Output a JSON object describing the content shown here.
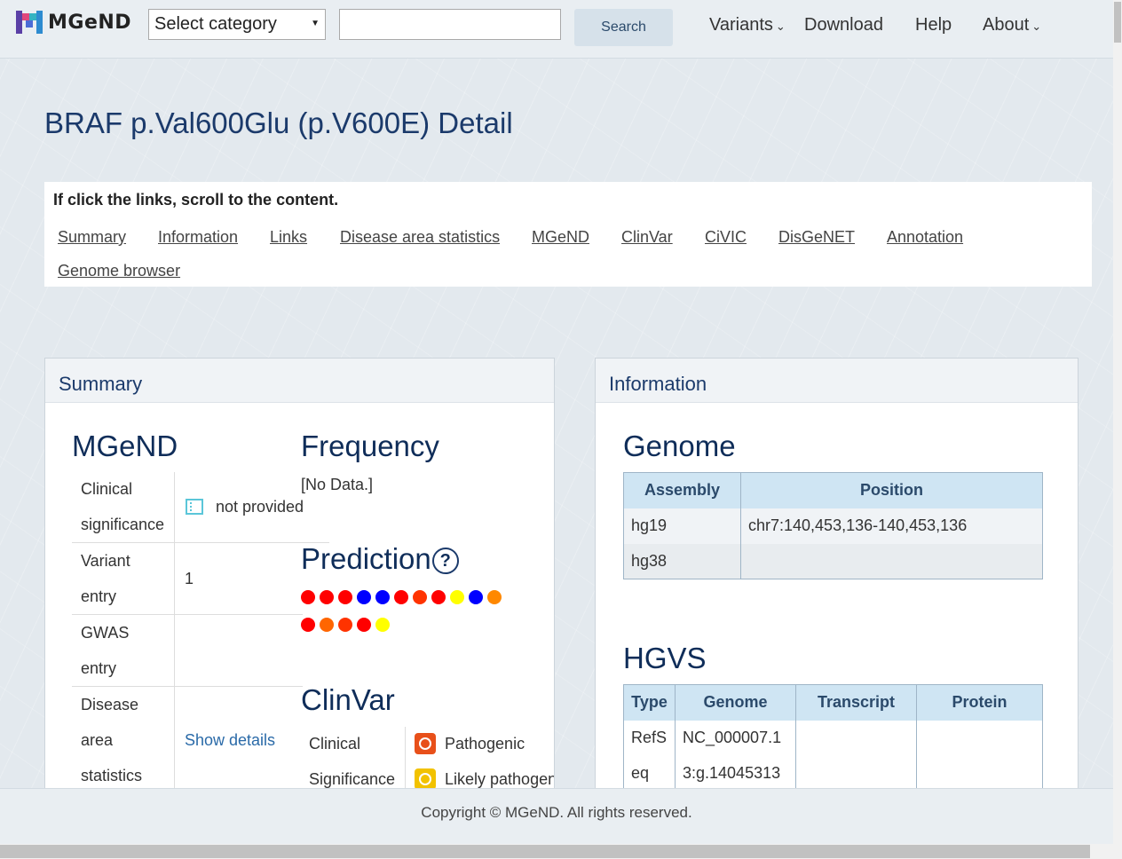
{
  "header": {
    "logo_text": "MGeND",
    "category_select": "Select category",
    "search_value": "",
    "search_button": "Search",
    "nav": [
      {
        "label": "Variants",
        "has_dropdown": true
      },
      {
        "label": "Download",
        "has_dropdown": false
      },
      {
        "label": "Help",
        "has_dropdown": false
      },
      {
        "label": "About",
        "has_dropdown": true
      }
    ]
  },
  "page_title": "BRAF p.Val600Glu (p.V600E) Detail",
  "jump": {
    "hint": "If click the links, scroll to the content.",
    "links": [
      "Summary",
      "Information",
      "Links",
      "Disease area statistics",
      "MGeND",
      "ClinVar",
      "CiVIC",
      "DisGeNET",
      "Annotation",
      "Genome browser"
    ]
  },
  "summary": {
    "panel_title": "Summary",
    "mgend": {
      "heading": "MGeND",
      "rows": [
        {
          "label_lines": [
            "Clinical",
            "significance"
          ],
          "value": "not provided"
        },
        {
          "label_lines": [
            "Variant",
            "entry"
          ],
          "value": "1"
        },
        {
          "label_lines": [
            "GWAS",
            "entry"
          ],
          "value": ""
        },
        {
          "label_lines": [
            "Disease",
            "area",
            "statistics"
          ],
          "value": "Show details"
        }
      ]
    },
    "frequency": {
      "heading": "Frequency",
      "value": "[No Data.]"
    },
    "prediction": {
      "heading": "Prediction",
      "help_icon": "question-icon",
      "dots_row1": [
        "#ff0000",
        "#ff0000",
        "#ff0000",
        "#0000ff",
        "#0000ff",
        "#ff0000",
        "#ff3300",
        "#ff0000",
        "#ffff00",
        "#0000ff",
        "#ff8800"
      ],
      "dots_row2": [
        "#ff0000",
        "#ff6600",
        "#ff3300",
        "#ff0000",
        "#ffff00"
      ]
    },
    "clinvar": {
      "heading": "ClinVar",
      "label_lines": [
        "Clinical",
        "Significance"
      ],
      "items": [
        {
          "label": "Pathogenic",
          "icon": "pathogenic-icon",
          "color": "#e8501a"
        },
        {
          "label": "Likely pathogen",
          "icon": "likely-pathogenic-icon",
          "color": "#f2c200"
        }
      ]
    }
  },
  "information": {
    "panel_title": "Information",
    "genome": {
      "heading": "Genome",
      "columns": [
        "Assembly",
        "Position"
      ],
      "rows": [
        [
          "hg19",
          "chr7:140,453,136-140,453,136"
        ],
        [
          "hg38",
          ""
        ]
      ]
    },
    "hgvs": {
      "heading": "HGVS",
      "columns": [
        "Type",
        "Genome",
        "Transcript",
        "Protein"
      ],
      "rows": [
        [
          "RefS",
          "NC_000007.1",
          "",
          ""
        ],
        [
          "eq",
          "3:g.14045313",
          "",
          ""
        ]
      ]
    }
  },
  "footer": {
    "copyright": "Copyright © MGeND. All rights reserved."
  },
  "colors": {
    "title": "#1b3a6b",
    "table_header": "#cfe5f3",
    "link": "#2a6aa8"
  }
}
